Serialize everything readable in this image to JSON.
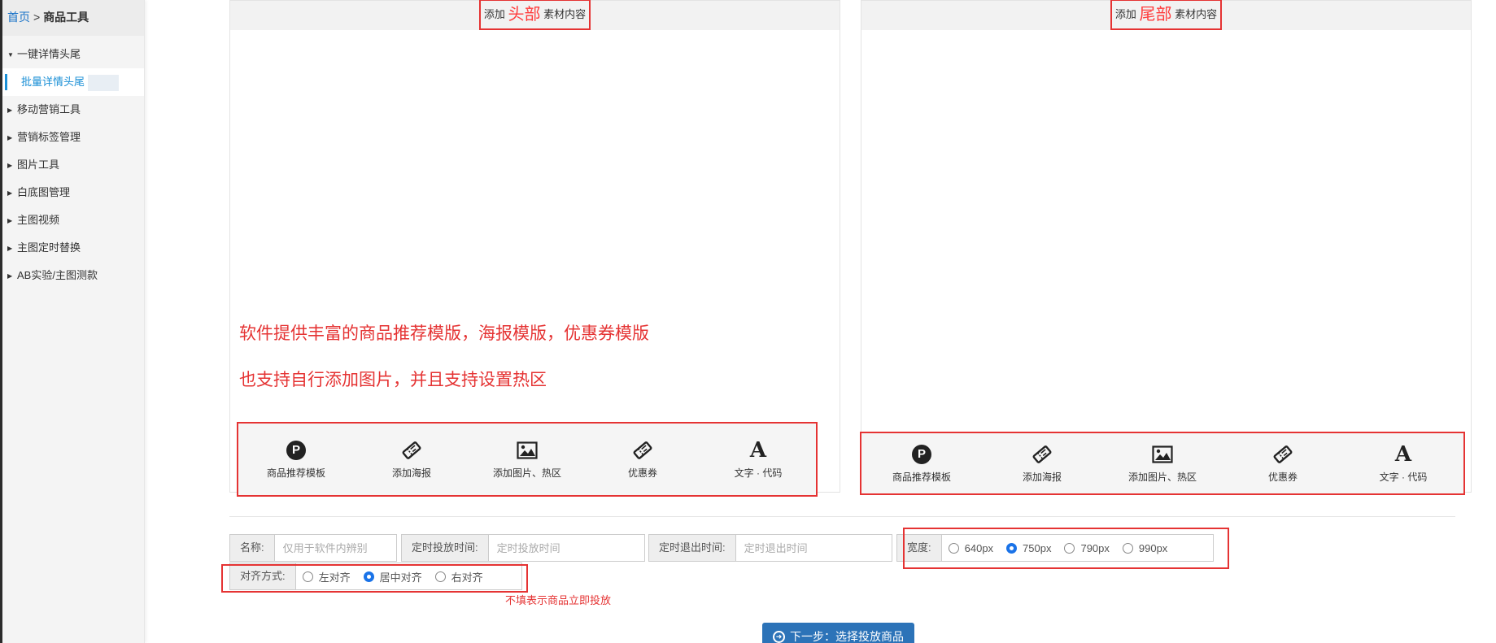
{
  "breadcrumb": {
    "home": "首页",
    "separator": ">",
    "current": "商品工具"
  },
  "sidebar": {
    "items": [
      {
        "label": "一键详情头尾",
        "expanded": true
      },
      {
        "label": "批量详情头尾",
        "active": true
      },
      {
        "label": "移动营销工具"
      },
      {
        "label": "营销标签管理"
      },
      {
        "label": "图片工具"
      },
      {
        "label": "白底图管理"
      },
      {
        "label": "主图视频"
      },
      {
        "label": "主图定时替换"
      },
      {
        "label": "AB实验/主图测款"
      }
    ]
  },
  "header_panel": {
    "add_prefix": "添加",
    "part": "头部",
    "suffix": "素材内容",
    "note1": "软件提供丰富的商品推荐模版，海报模版，优惠券模版",
    "note2": "也支持自行添加图片，并且支持设置热区"
  },
  "footer_panel": {
    "add_prefix": "添加",
    "part": "尾部",
    "suffix": "素材内容"
  },
  "tools": [
    {
      "label": "商品推荐模板",
      "icon": "p-circle-icon"
    },
    {
      "label": "添加海报",
      "icon": "ticket-icon"
    },
    {
      "label": "添加图片、热区",
      "icon": "image-icon"
    },
    {
      "label": "优惠券",
      "icon": "ticket-icon"
    },
    {
      "label": "文字 · 代码",
      "icon": "text-a-icon"
    }
  ],
  "form": {
    "name_label": "名称:",
    "name_placeholder": "仅用于软件内辨别",
    "start_label": "定时投放时间:",
    "start_placeholder": "定时投放时间",
    "end_label": "定时退出时间:",
    "end_placeholder": "定时退出时间",
    "width_label": "宽度:",
    "width_options": [
      "640px",
      "750px",
      "790px",
      "990px"
    ],
    "width_selected": "750px",
    "align_label": "对齐方式:",
    "align_options": [
      "左对齐",
      "居中对齐",
      "右对齐"
    ],
    "align_selected": "居中对齐",
    "hint": "不填表示商品立即投放"
  },
  "next_button": "下一步：选择投放商品",
  "colors": {
    "accent": "#1a73e8",
    "annotation_red": "#e53333",
    "button_blue": "#2c73b8"
  }
}
